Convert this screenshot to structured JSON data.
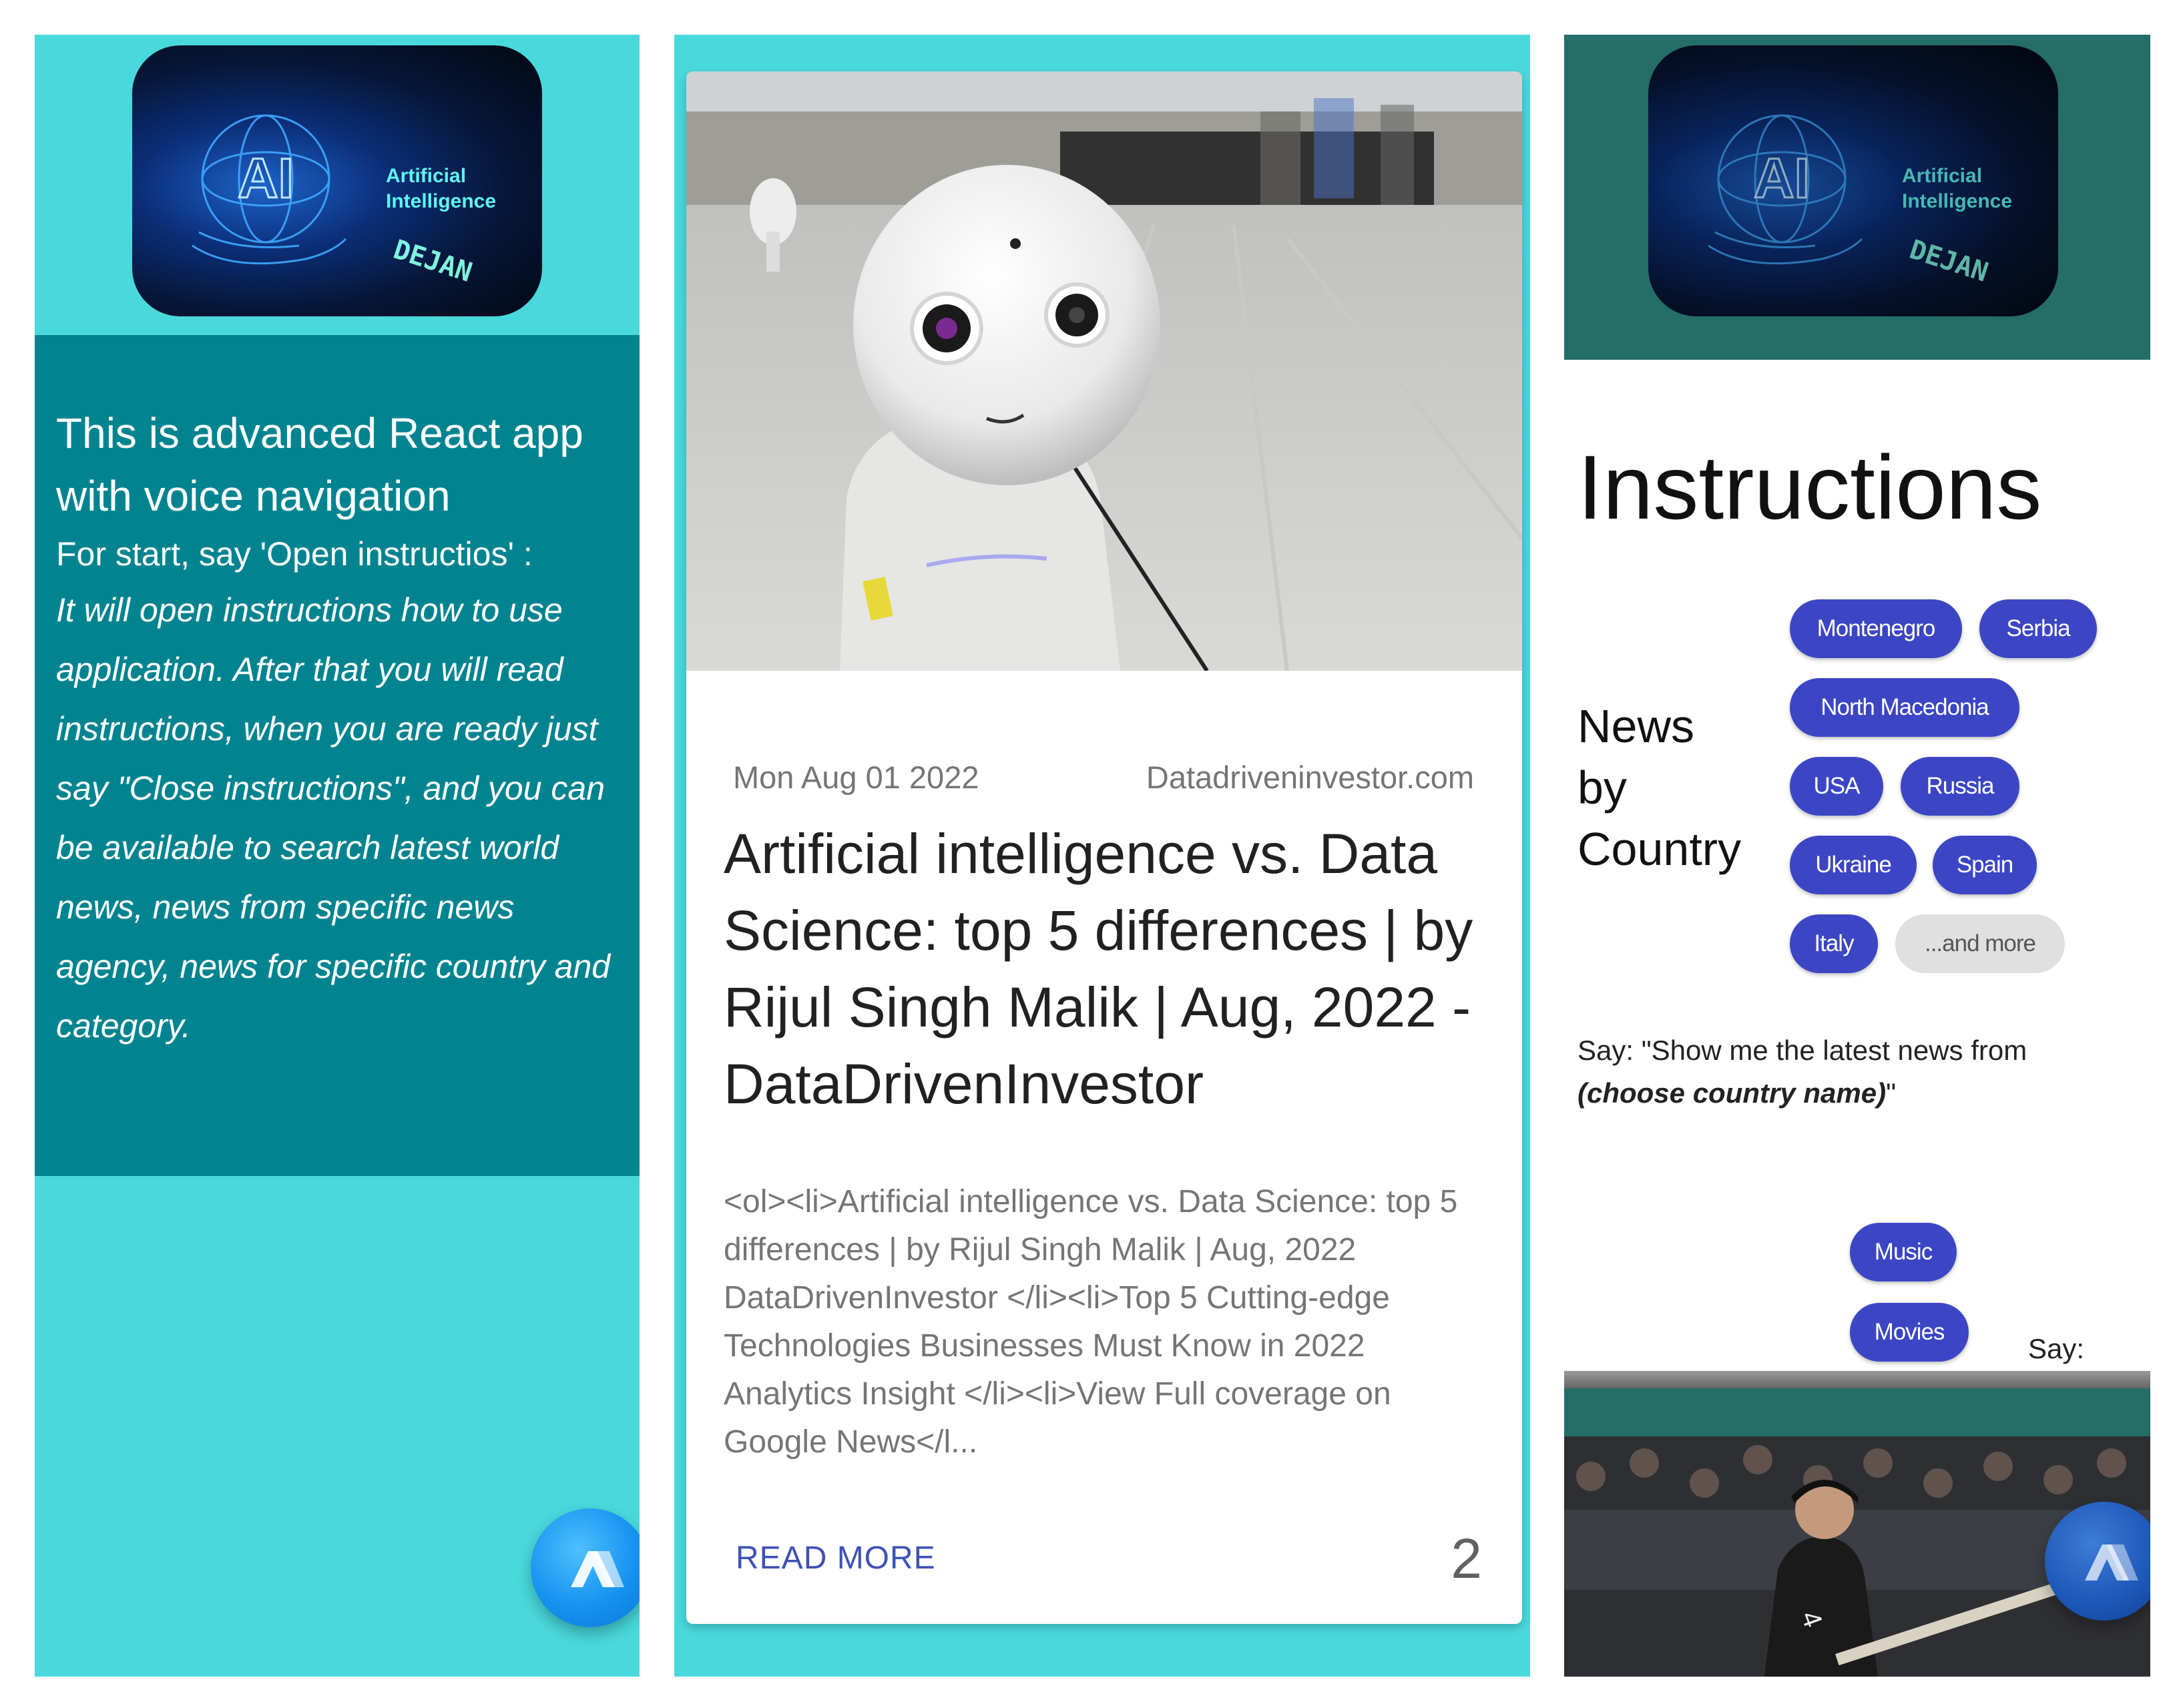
{
  "logo": {
    "ai_text": "AI",
    "title_line1": "Artificial",
    "title_line2": "Intelligence",
    "signature": "DEJAN"
  },
  "intro": {
    "title": "This is advanced React app with voice navigation",
    "subtitle": "For start, say 'Open instructios' :",
    "body": "It will open instructions how to use application. After that you will read instructions, when you are ready just say \"Close instructions\", and you can be available to search latest world news, news from specific news agency, news for specific country and category."
  },
  "article": {
    "date": "Mon Aug 01 2022",
    "source": "Datadriveninvestor.com",
    "title": "Artificial intelligence vs. Data Science: top 5 differences | by Rijul Singh Malik | Aug, 2022 - DataDrivenInvestor",
    "description": "<ol><li>Artificial intelligence vs. Data Science: top 5 differences | by Rijul Singh Malik | Aug, 2022  DataDrivenInvestor </li><li>Top 5 Cutting-edge Technologies Businesses Must Know in 2022  Analytics Insight </li><li>View Full coverage on Google News</l...",
    "read_more": "READ MORE",
    "index": "2"
  },
  "instructions": {
    "title": "Instructions",
    "news_by_country_label": "News by Country",
    "countries": [
      "Montenegro",
      "Serbia",
      "North Macedonia",
      "USA",
      "Russia",
      "Ukraine",
      "Spain",
      "Italy"
    ],
    "more_chip": "...and more",
    "say_prefix": "Say: \"Show me the latest news from ",
    "say_emphasis": "(choose country name)",
    "say_suffix": "\"",
    "categories": [
      "Music",
      "Movies"
    ],
    "say_label": "Say:"
  },
  "colors": {
    "cyan_background": "#49d9dd",
    "teal_box": "#028490",
    "dark_teal_header": "#246d68",
    "chip_blue": "#3c46c4",
    "read_more_blue": "#3f51b5",
    "fab_blue": "#1592ef"
  },
  "icons": [
    "alan-ai-fab-icon",
    "robot-photo",
    "baseball-photo",
    "ai-brain-hand-logo"
  ]
}
